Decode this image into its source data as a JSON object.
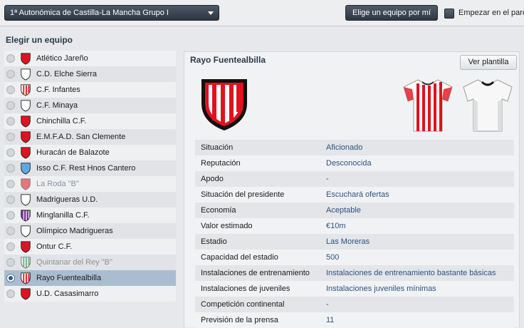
{
  "header": {
    "league": "1ª Autonómica de Castilla-La Mancha Grupo I",
    "pick_button": "Elige un equipo por mí",
    "start_label": "Empezar en el paro"
  },
  "sidebar": {
    "title": "Elegir un equipo",
    "teams": [
      {
        "name": "Atlético Jareño",
        "crest": "red-shield-crest"
      },
      {
        "name": "C.D. Elche Sierra",
        "crest": "white-shield-crest"
      },
      {
        "name": "C.F. Infantes",
        "crest": "red-white-striped-crest"
      },
      {
        "name": "C.F. Minaya",
        "crest": "white-shield-crest"
      },
      {
        "name": "Chinchilla C.F.",
        "crest": "red-shield-crest"
      },
      {
        "name": "E.M.F.A.D. San Clemente",
        "crest": "red-shield-crest"
      },
      {
        "name": "Huracán de Balazote",
        "crest": "red-shield-crest"
      },
      {
        "name": "Isso C.F. Rest Hnos Cantero",
        "crest": "blue-shield-crest"
      },
      {
        "name": "La Roda \"B\"",
        "crest": "red-shield-crest"
      },
      {
        "name": "Madrigueras U.D.",
        "crest": "white-shield-crest"
      },
      {
        "name": "Minglanilla C.F.",
        "crest": "purple-striped-crest"
      },
      {
        "name": "Olímpico Madrigueras",
        "crest": "white-shield-crest"
      },
      {
        "name": "Ontur C.F.",
        "crest": "red-shield-crest"
      },
      {
        "name": "Quintanar del Rey \"B\"",
        "crest": "green-white-striped-crest"
      },
      {
        "name": "Rayo Fuentealbilla",
        "crest": "red-white-striped-crest"
      },
      {
        "name": "U.D. Casasimarro",
        "crest": "red-shield-crest"
      }
    ]
  },
  "detail": {
    "team_name": "Rayo Fuentealbilla",
    "squad_button": "Ver plantilla",
    "rows": [
      {
        "label": "Situación",
        "value": "Aficionado"
      },
      {
        "label": "Reputación",
        "value": "Desconocida"
      },
      {
        "label": "Apodo",
        "value": "-"
      },
      {
        "label": "Situación del presidente",
        "value": "Escuchará ofertas"
      },
      {
        "label": "Economía",
        "value": "Aceptable"
      },
      {
        "label": "Valor estimado",
        "value": "€10m"
      },
      {
        "label": "Estadio",
        "value": "Las Moreras"
      },
      {
        "label": "Capacidad del estadio",
        "value": "500"
      },
      {
        "label": "Instalaciones de entrenamiento",
        "value": "Instalaciones de entrenamiento bastante básicas"
      },
      {
        "label": "Instalaciones de juveniles",
        "value": "Instalaciones juveniles mínimas"
      },
      {
        "label": "Competición continental",
        "value": "-"
      },
      {
        "label": "Previsión de la prensa",
        "value": "11"
      }
    ]
  },
  "colors": {
    "accent_blue": "#2c5283",
    "selected_row": "#aabdd0",
    "crest_red": "#e0121f"
  }
}
